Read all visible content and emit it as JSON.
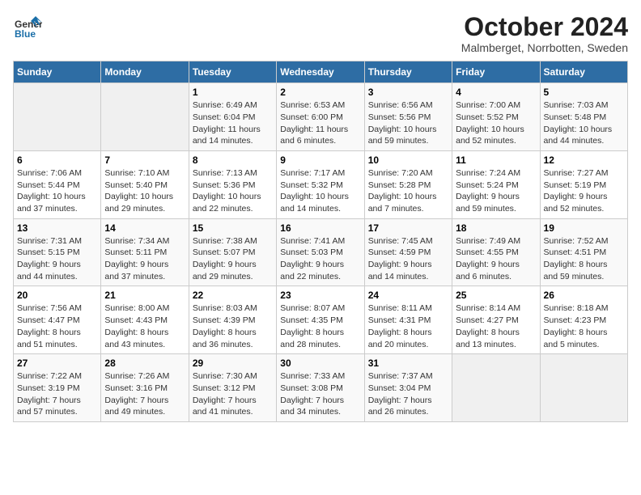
{
  "header": {
    "logo_general": "General",
    "logo_blue": "Blue",
    "title": "October 2024",
    "subtitle": "Malmberget, Norrbotten, Sweden"
  },
  "weekdays": [
    "Sunday",
    "Monday",
    "Tuesday",
    "Wednesday",
    "Thursday",
    "Friday",
    "Saturday"
  ],
  "weeks": [
    [
      {
        "day": "",
        "detail": ""
      },
      {
        "day": "",
        "detail": ""
      },
      {
        "day": "1",
        "detail": "Sunrise: 6:49 AM\nSunset: 6:04 PM\nDaylight: 11 hours\nand 14 minutes."
      },
      {
        "day": "2",
        "detail": "Sunrise: 6:53 AM\nSunset: 6:00 PM\nDaylight: 11 hours\nand 6 minutes."
      },
      {
        "day": "3",
        "detail": "Sunrise: 6:56 AM\nSunset: 5:56 PM\nDaylight: 10 hours\nand 59 minutes."
      },
      {
        "day": "4",
        "detail": "Sunrise: 7:00 AM\nSunset: 5:52 PM\nDaylight: 10 hours\nand 52 minutes."
      },
      {
        "day": "5",
        "detail": "Sunrise: 7:03 AM\nSunset: 5:48 PM\nDaylight: 10 hours\nand 44 minutes."
      }
    ],
    [
      {
        "day": "6",
        "detail": "Sunrise: 7:06 AM\nSunset: 5:44 PM\nDaylight: 10 hours\nand 37 minutes."
      },
      {
        "day": "7",
        "detail": "Sunrise: 7:10 AM\nSunset: 5:40 PM\nDaylight: 10 hours\nand 29 minutes."
      },
      {
        "day": "8",
        "detail": "Sunrise: 7:13 AM\nSunset: 5:36 PM\nDaylight: 10 hours\nand 22 minutes."
      },
      {
        "day": "9",
        "detail": "Sunrise: 7:17 AM\nSunset: 5:32 PM\nDaylight: 10 hours\nand 14 minutes."
      },
      {
        "day": "10",
        "detail": "Sunrise: 7:20 AM\nSunset: 5:28 PM\nDaylight: 10 hours\nand 7 minutes."
      },
      {
        "day": "11",
        "detail": "Sunrise: 7:24 AM\nSunset: 5:24 PM\nDaylight: 9 hours\nand 59 minutes."
      },
      {
        "day": "12",
        "detail": "Sunrise: 7:27 AM\nSunset: 5:19 PM\nDaylight: 9 hours\nand 52 minutes."
      }
    ],
    [
      {
        "day": "13",
        "detail": "Sunrise: 7:31 AM\nSunset: 5:15 PM\nDaylight: 9 hours\nand 44 minutes."
      },
      {
        "day": "14",
        "detail": "Sunrise: 7:34 AM\nSunset: 5:11 PM\nDaylight: 9 hours\nand 37 minutes."
      },
      {
        "day": "15",
        "detail": "Sunrise: 7:38 AM\nSunset: 5:07 PM\nDaylight: 9 hours\nand 29 minutes."
      },
      {
        "day": "16",
        "detail": "Sunrise: 7:41 AM\nSunset: 5:03 PM\nDaylight: 9 hours\nand 22 minutes."
      },
      {
        "day": "17",
        "detail": "Sunrise: 7:45 AM\nSunset: 4:59 PM\nDaylight: 9 hours\nand 14 minutes."
      },
      {
        "day": "18",
        "detail": "Sunrise: 7:49 AM\nSunset: 4:55 PM\nDaylight: 9 hours\nand 6 minutes."
      },
      {
        "day": "19",
        "detail": "Sunrise: 7:52 AM\nSunset: 4:51 PM\nDaylight: 8 hours\nand 59 minutes."
      }
    ],
    [
      {
        "day": "20",
        "detail": "Sunrise: 7:56 AM\nSunset: 4:47 PM\nDaylight: 8 hours\nand 51 minutes."
      },
      {
        "day": "21",
        "detail": "Sunrise: 8:00 AM\nSunset: 4:43 PM\nDaylight: 8 hours\nand 43 minutes."
      },
      {
        "day": "22",
        "detail": "Sunrise: 8:03 AM\nSunset: 4:39 PM\nDaylight: 8 hours\nand 36 minutes."
      },
      {
        "day": "23",
        "detail": "Sunrise: 8:07 AM\nSunset: 4:35 PM\nDaylight: 8 hours\nand 28 minutes."
      },
      {
        "day": "24",
        "detail": "Sunrise: 8:11 AM\nSunset: 4:31 PM\nDaylight: 8 hours\nand 20 minutes."
      },
      {
        "day": "25",
        "detail": "Sunrise: 8:14 AM\nSunset: 4:27 PM\nDaylight: 8 hours\nand 13 minutes."
      },
      {
        "day": "26",
        "detail": "Sunrise: 8:18 AM\nSunset: 4:23 PM\nDaylight: 8 hours\nand 5 minutes."
      }
    ],
    [
      {
        "day": "27",
        "detail": "Sunrise: 7:22 AM\nSunset: 3:19 PM\nDaylight: 7 hours\nand 57 minutes."
      },
      {
        "day": "28",
        "detail": "Sunrise: 7:26 AM\nSunset: 3:16 PM\nDaylight: 7 hours\nand 49 minutes."
      },
      {
        "day": "29",
        "detail": "Sunrise: 7:30 AM\nSunset: 3:12 PM\nDaylight: 7 hours\nand 41 minutes."
      },
      {
        "day": "30",
        "detail": "Sunrise: 7:33 AM\nSunset: 3:08 PM\nDaylight: 7 hours\nand 34 minutes."
      },
      {
        "day": "31",
        "detail": "Sunrise: 7:37 AM\nSunset: 3:04 PM\nDaylight: 7 hours\nand 26 minutes."
      },
      {
        "day": "",
        "detail": ""
      },
      {
        "day": "",
        "detail": ""
      }
    ]
  ]
}
